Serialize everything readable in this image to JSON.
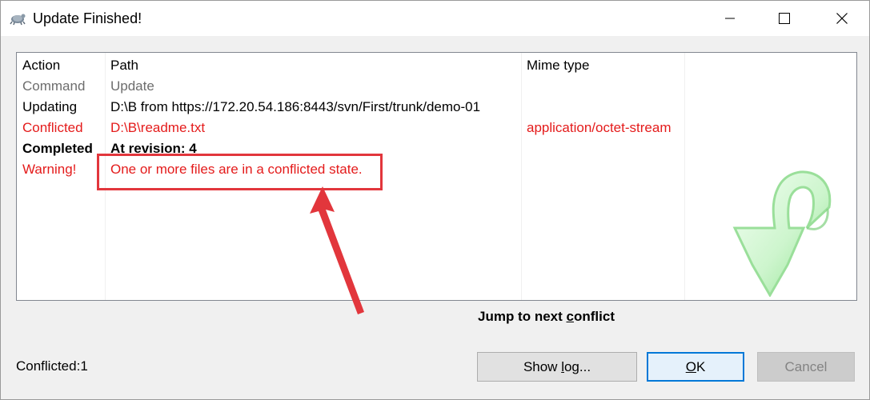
{
  "window": {
    "title": "Update Finished!"
  },
  "table": {
    "columns": [
      "Action",
      "Path",
      "Mime type"
    ],
    "rows": [
      {
        "action": "Command",
        "path": "Update",
        "mime": ""
      },
      {
        "action": "Updating",
        "path": "D:\\B from https://172.20.54.186:8443/svn/First/trunk/demo-01",
        "mime": ""
      },
      {
        "action": "Conflicted",
        "path": "D:\\B\\readme.txt",
        "mime": "application/octet-stream"
      },
      {
        "action": "Completed",
        "path": "At revision: 4",
        "mime": ""
      },
      {
        "action": "Warning!",
        "path": "One or more files are in a conflicted state.",
        "mime": ""
      }
    ]
  },
  "footer": {
    "jump_pre": "Jump to next ",
    "jump_u": "c",
    "jump_post": "onflict",
    "status": "Conflicted:1",
    "showlog_pre": "Show ",
    "showlog_u": "l",
    "showlog_post": "og...",
    "ok_u": "O",
    "ok_post": "K",
    "cancel": "Cancel"
  },
  "colors": {
    "conflict_red": "#e41b1b",
    "annotation_red": "#e2363c",
    "command_gray": "#6d6d6d",
    "default_button_border": "#0078d7"
  },
  "icons": {
    "app": "tortoise-svn-icon",
    "minimize": "minimize-icon",
    "maximize": "maximize-icon",
    "close": "close-icon",
    "decoration": "green-curved-arrow-icon",
    "annotation": "red-pointer-arrow"
  }
}
